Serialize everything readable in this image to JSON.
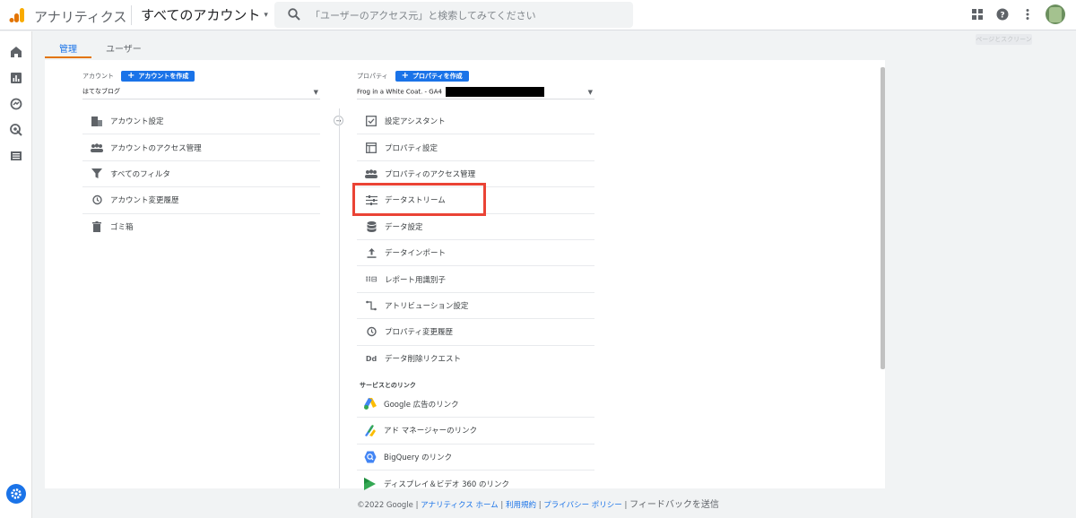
{
  "header": {
    "app_title": "アナリティクス",
    "account_picker": "すべてのアカウント",
    "search_placeholder": "「ユーザーのアクセス元」と検索してみてください",
    "ghost_tooltip": "ページとスクリーン"
  },
  "tabs": [
    {
      "label": "管理",
      "active": true
    },
    {
      "label": "ユーザー",
      "active": false
    }
  ],
  "account_column": {
    "heading": "アカウント",
    "create_label": "アカウントを作成",
    "selected": "はてなブログ",
    "items": [
      {
        "label": "アカウント設定",
        "icon": "building-icon"
      },
      {
        "label": "アカウントのアクセス管理",
        "icon": "people-icon"
      },
      {
        "label": "すべてのフィルタ",
        "icon": "filter-icon"
      },
      {
        "label": "アカウント変更履歴",
        "icon": "history-icon"
      },
      {
        "label": "ゴミ箱",
        "icon": "trash-icon"
      }
    ]
  },
  "property_column": {
    "heading": "プロパティ",
    "create_label": "プロパティを作成",
    "selected": "Frog in a White Coat. - GA4",
    "items": [
      {
        "label": "設定アシスタント",
        "icon": "checkbox-icon"
      },
      {
        "label": "プロパティ設定",
        "icon": "layout-icon"
      },
      {
        "label": "プロパティのアクセス管理",
        "icon": "people-icon"
      },
      {
        "label": "データストリーム",
        "icon": "streams-icon"
      },
      {
        "label": "データ設定",
        "icon": "database-icon"
      },
      {
        "label": "データインポート",
        "icon": "upload-icon"
      },
      {
        "label": "レポート用識別子",
        "icon": "identifier-icon"
      },
      {
        "label": "アトリビューション設定",
        "icon": "attribution-icon"
      },
      {
        "label": "プロパティ変更履歴",
        "icon": "history-icon"
      },
      {
        "label": "データ削除リクエスト",
        "icon": "dd-icon"
      }
    ],
    "links_section_label": "サービスとのリンク",
    "links": [
      {
        "label": "Google 広告のリンク",
        "icon": "google-ads-icon"
      },
      {
        "label": "アド マネージャーのリンク",
        "icon": "ad-manager-icon"
      },
      {
        "label": "BigQuery のリンク",
        "icon": "bigquery-icon"
      },
      {
        "label": "ディスプレイ＆ビデオ 360 のリンク",
        "icon": "dv360-icon"
      }
    ]
  },
  "footer": {
    "copyright": "©2022 Google |",
    "home": "アナリティクス ホーム",
    "sep1": "|",
    "terms": "利用規約",
    "sep2": "|",
    "privacy": "プライバシー ポリシー",
    "sep3": "|",
    "feedback": "フィードバックを送信"
  },
  "colors": {
    "accent": "#1a73e8",
    "tab_underline": "#e37400",
    "highlight_box": "#ea4335"
  }
}
